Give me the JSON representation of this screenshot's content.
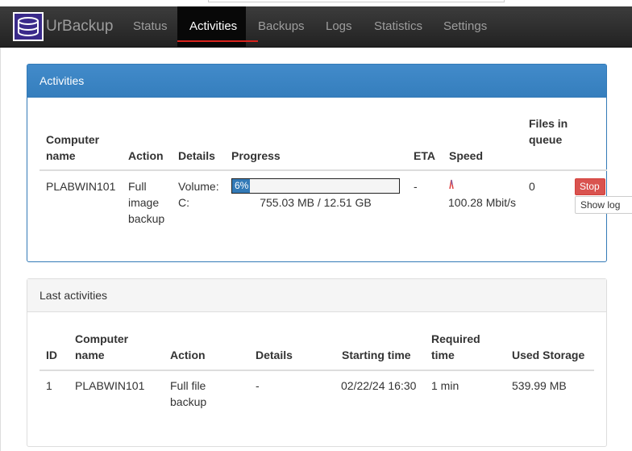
{
  "app": {
    "brand": "UrBackup",
    "nav": [
      {
        "label": "Status"
      },
      {
        "label": "Activities"
      },
      {
        "label": "Backups"
      },
      {
        "label": "Logs"
      },
      {
        "label": "Statistics"
      },
      {
        "label": "Settings"
      }
    ],
    "active_nav": "Activities",
    "accent_color": "#d9231d",
    "panel_primary_color": "#337ab7"
  },
  "activities": {
    "title": "Activities",
    "headers": {
      "computer_name": "Computer name",
      "action": "Action",
      "details": "Details",
      "progress": "Progress",
      "eta": "ETA",
      "speed": "Speed",
      "files_in_queue": "Files in queue"
    },
    "rows": [
      {
        "computer_name": "PLABWIN101",
        "action": "Full image backup",
        "details": "Volume: C:",
        "progress_percent": 6,
        "progress_label": "6%",
        "progress_text": "755.03 MB / 12.51 GB",
        "eta": "-",
        "speed": "100.28 Mbit/s",
        "files_in_queue": "0",
        "stop_label": "Stop",
        "show_log_label": "Show log"
      }
    ]
  },
  "last_activities": {
    "title": "Last activities",
    "headers": {
      "id": "ID",
      "computer_name": "Computer name",
      "action": "Action",
      "details": "Details",
      "starting_time": "Starting time",
      "required_time": "Required time",
      "used_storage": "Used Storage"
    },
    "rows": [
      {
        "id": "1",
        "computer_name": "PLABWIN101",
        "action": "Full file backup",
        "details": "-",
        "starting_time": "02/22/24 16:30",
        "required_time": "1 min",
        "used_storage": "539.99 MB"
      }
    ]
  }
}
